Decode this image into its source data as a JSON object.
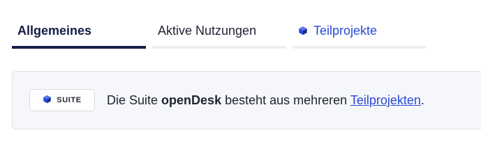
{
  "tabs": {
    "general_label": "Allgemeines",
    "active_usage_label": "Aktive Nutzungen",
    "subprojects_label": "Teilprojekte",
    "subprojects_icon": "cube-icon"
  },
  "info": {
    "badge_icon": "cube-icon",
    "badge_label": "SUITE",
    "text_before": "Die Suite ",
    "suite_name": "openDesk",
    "text_middle": " besteht aus mehreren ",
    "link_label": "Teilprojekten",
    "text_after": "."
  },
  "colors": {
    "accent": "#2a49d8",
    "active_tab": "#161d45"
  }
}
